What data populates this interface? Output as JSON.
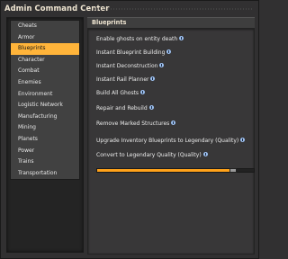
{
  "window": {
    "title": "Admin Command Center"
  },
  "sidebar": {
    "items": [
      {
        "label": "Cheats",
        "selected": false
      },
      {
        "label": "Armor",
        "selected": false
      },
      {
        "label": "Blueprints",
        "selected": true
      },
      {
        "label": "Character",
        "selected": false
      },
      {
        "label": "Combat",
        "selected": false
      },
      {
        "label": "Enemies",
        "selected": false
      },
      {
        "label": "Environment",
        "selected": false
      },
      {
        "label": "Logistic Network",
        "selected": false
      },
      {
        "label": "Manufacturing",
        "selected": false
      },
      {
        "label": "Mining",
        "selected": false
      },
      {
        "label": "Planets",
        "selected": false
      },
      {
        "label": "Power",
        "selected": false
      },
      {
        "label": "Trains",
        "selected": false
      },
      {
        "label": "Transportation",
        "selected": false
      }
    ]
  },
  "panel": {
    "title": "Blueprints",
    "settings": [
      {
        "label": "Enable ghosts on entity death",
        "icon": "info-icon"
      },
      {
        "label": "Instant Blueprint Building",
        "icon": "info-icon"
      },
      {
        "label": "Instant Deconstruction",
        "icon": "info-icon"
      },
      {
        "label": "Instant Rail Planner",
        "icon": "info-icon"
      },
      {
        "label": "Build All Ghosts",
        "icon": "info-icon"
      },
      {
        "label": "Repair and Rebuild",
        "icon": "info-icon"
      },
      {
        "label": "Remove Marked Structures",
        "icon": "info-icon"
      },
      {
        "label": "Upgrade Inventory Blueprints to Legendary (Quality)",
        "icon": "info-icon"
      },
      {
        "label": "Convert to Legendary Quality (Quality)",
        "icon": "info-icon"
      }
    ],
    "slider": {
      "value_fraction": 0.87,
      "fill_color": "#ffa21a"
    }
  },
  "colors": {
    "accent": "#ffb43a",
    "background": "#313031"
  }
}
